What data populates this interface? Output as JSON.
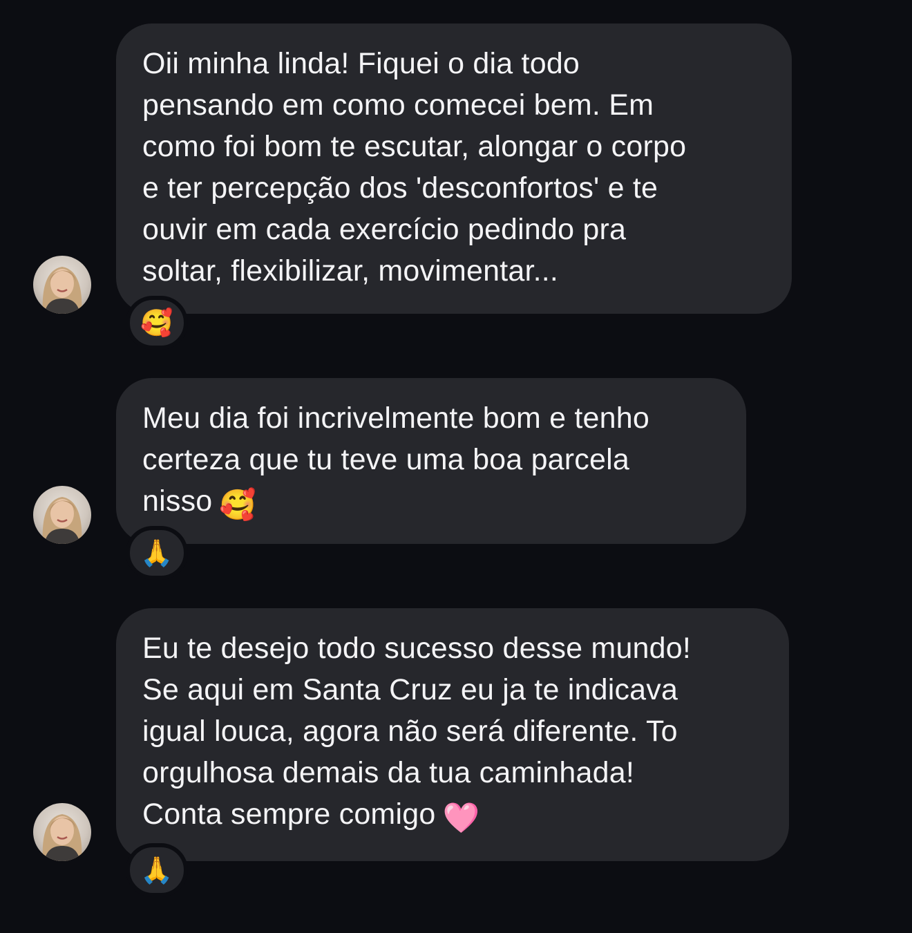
{
  "colors": {
    "background": "#0c0d12",
    "bubble": "#26272c",
    "text": "#f4f4f6"
  },
  "messages": [
    {
      "lines": [
        "Oii minha linda! Fiquei o dia todo",
        "pensando em como comecei bem. Em",
        "como foi bom te escutar, alongar o corpo",
        "e ter percepção dos 'desconfortos' e te",
        "ouvir em cada exercício pedindo pra",
        "soltar, flexibilizar, movimentar..."
      ],
      "trailing_emoji": "",
      "reaction": "🥰",
      "reaction_icon": "smiling-face-with-hearts-icon"
    },
    {
      "lines": [
        "Meu dia foi incrivelmente bom e tenho",
        "certeza que tu teve uma boa parcela",
        "nisso"
      ],
      "trailing_emoji": "🥰",
      "reaction": "🙏",
      "reaction_icon": "folded-hands-icon"
    },
    {
      "lines": [
        "Eu te desejo todo sucesso desse mundo!",
        "Se aqui em Santa Cruz eu ja te indicava",
        "igual louca, agora não será diferente. To",
        "orgulhosa demais da tua caminhada!",
        "Conta sempre comigo"
      ],
      "trailing_emoji": "🩷",
      "reaction": "🙏",
      "reaction_icon": "folded-hands-icon"
    }
  ]
}
